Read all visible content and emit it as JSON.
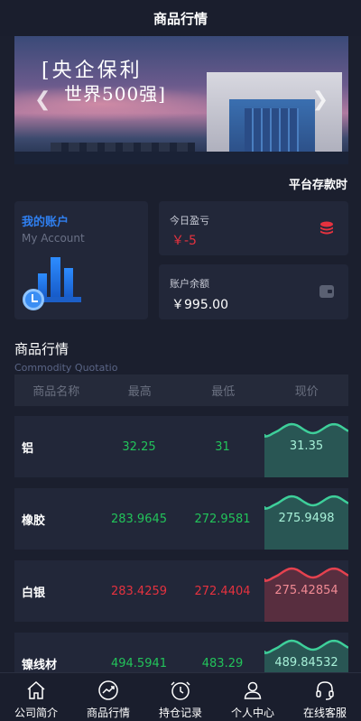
{
  "header": {
    "title": "商品行情"
  },
  "banner": {
    "slogan_line1": "[央企保利",
    "slogan_line2": "世界500强]",
    "prev_icon": "chevron-left-icon",
    "next_icon": "chevron-right-icon"
  },
  "ticker": {
    "text": "平台存款时"
  },
  "account": {
    "title": "我的账户",
    "subtitle": "My Account",
    "icon": "bar-chart-clock-icon",
    "accent": "#2f7ff0"
  },
  "pnl": {
    "label": "今日盈亏",
    "value": "￥-5",
    "icon": "coin-stack-icon",
    "color": "#e5323f"
  },
  "balance": {
    "label": "账户余额",
    "value": "￥995.00",
    "icon": "wallet-icon"
  },
  "market": {
    "title": "商品行情",
    "subtitle": "Commodity Quotatio",
    "columns": [
      "商品名称",
      "最高",
      "最低",
      "现价"
    ],
    "rows": [
      {
        "name": "铝",
        "high": "32.25",
        "low": "31",
        "current": "31.35",
        "trend": "up"
      },
      {
        "name": "橡胶",
        "high": "283.9645",
        "low": "272.9581",
        "current": "275.9498",
        "trend": "up"
      },
      {
        "name": "白银",
        "high": "283.4259",
        "low": "272.4404",
        "current": "275.42854",
        "trend": "down"
      },
      {
        "name": "镍线材",
        "high": "494.5941",
        "low": "483.29",
        "current": "489.84532",
        "trend": "up"
      }
    ]
  },
  "colors": {
    "up": "#22c35a",
    "down": "#e5323f",
    "up_wave": "#3ecf9a",
    "down_wave": "#e5424f"
  },
  "tabbar": [
    {
      "label": "公司简介",
      "icon": "home-icon"
    },
    {
      "label": "商品行情",
      "icon": "trend-chart-icon"
    },
    {
      "label": "持仓记录",
      "icon": "clock-icon"
    },
    {
      "label": "个人中心",
      "icon": "user-icon"
    },
    {
      "label": "在线客服",
      "icon": "headset-icon"
    }
  ]
}
